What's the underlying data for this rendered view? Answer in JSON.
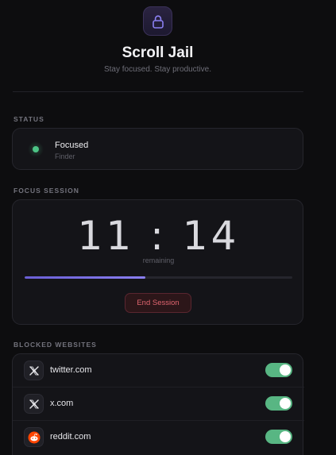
{
  "app": {
    "title": "Scroll Jail",
    "subtitle": "Stay focused. Stay productive.",
    "icon": "lock-icon",
    "accent": "#8a7ff0"
  },
  "status": {
    "section_label": "STATUS",
    "state": "Focused",
    "app_name": "Finder",
    "indicator_color": "#4cc385"
  },
  "focus_session": {
    "section_label": "FOCUS SESSION",
    "time": "11:14",
    "time_display": "11 : 14",
    "remaining_label": "remaining",
    "progress_percent": 45,
    "end_button_label": "End Session",
    "end_button_color": "#e0656f"
  },
  "blocked_websites": {
    "section_label": "BLOCKED WEBSITES",
    "items": [
      {
        "name": "twitter.com",
        "icon": "x-logo-icon",
        "enabled": true
      },
      {
        "name": "x.com",
        "icon": "x-logo-icon",
        "enabled": true
      },
      {
        "name": "reddit.com",
        "icon": "reddit-logo-icon",
        "enabled": true
      }
    ],
    "toggle_color": "#58b683"
  }
}
